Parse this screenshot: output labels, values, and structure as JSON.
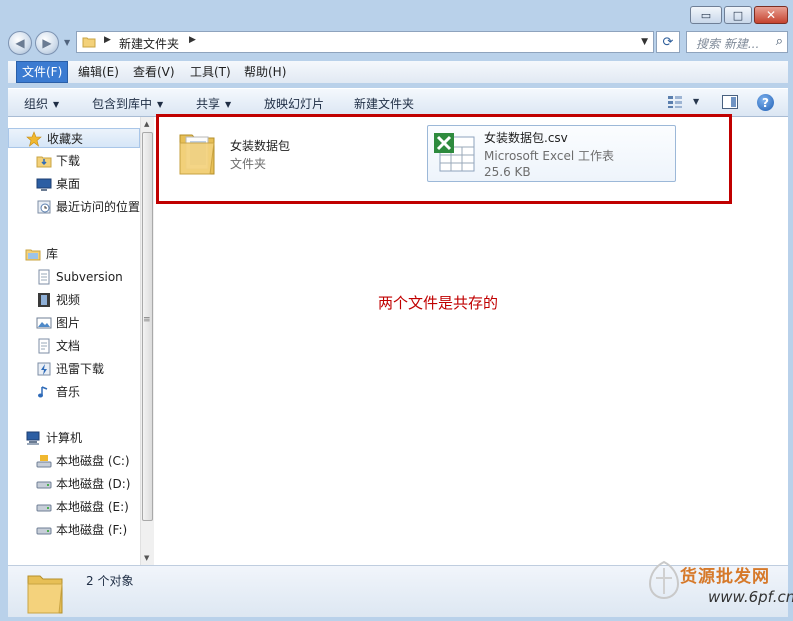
{
  "window": {
    "controls": {
      "minimize": "▭",
      "maximize": "□",
      "close": "✕"
    }
  },
  "nav": {
    "back_icon": "back-arrow-icon",
    "forward_icon": "forward-arrow-icon",
    "address": {
      "crumb": "新建文件夹"
    },
    "search": {
      "placeholder": "搜索 新建..."
    }
  },
  "menu": {
    "items": [
      "文件(F)",
      "编辑(E)",
      "查看(V)",
      "工具(T)",
      "帮助(H)"
    ],
    "active_index": 0
  },
  "toolbar": {
    "organize": "组织",
    "include_in_library": "包含到库中",
    "share": "共享",
    "slideshow": "放映幻灯片",
    "new_folder": "新建文件夹"
  },
  "sidebar": {
    "favorites": {
      "label": "收藏夹",
      "items": [
        "下载",
        "桌面",
        "最近访问的位置"
      ]
    },
    "libraries": {
      "label": "库",
      "items": [
        "Subversion",
        "视频",
        "图片",
        "文档",
        "迅雷下载",
        "音乐"
      ]
    },
    "computer": {
      "label": "计算机",
      "items": [
        "本地磁盘 (C:)",
        "本地磁盘 (D:)",
        "本地磁盘 (E:)",
        "本地磁盘 (F:)"
      ]
    }
  },
  "files": [
    {
      "name": "女装数据包",
      "type": "文件夹",
      "icon": "folder-icon"
    },
    {
      "name": "女装数据包.csv",
      "type": "Microsoft Excel 工作表",
      "size": "25.6 KB",
      "icon": "excel-icon"
    }
  ],
  "annotation": {
    "text": "两个文件是共存的",
    "color": "#c00000"
  },
  "status": {
    "count_text": "2 个对象"
  },
  "watermark": {
    "line1": "货源批发网",
    "line2": "www.6pf.cn"
  },
  "colors": {
    "accent": "#3b7bd1",
    "highlight_border": "#c00000"
  }
}
